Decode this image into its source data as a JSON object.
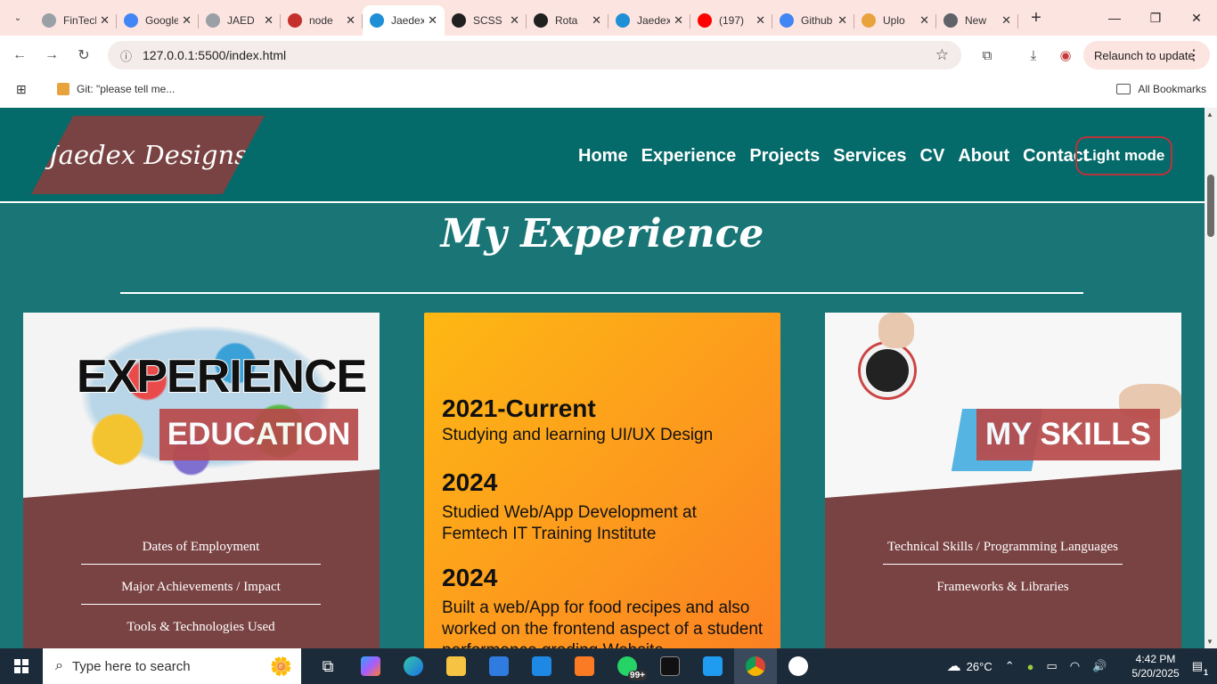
{
  "browser": {
    "tabs": [
      {
        "title": "FinTech",
        "fav_color": "#9aa0a6",
        "active": false
      },
      {
        "title": "Google",
        "fav_color": "#4285f4",
        "active": false
      },
      {
        "title": "JAED",
        "fav_color": "#9aa0a6",
        "active": false
      },
      {
        "title": "node",
        "fav_color": "#c4302b",
        "active": false
      },
      {
        "title": "Jaedex",
        "fav_color": "#1f8fd6",
        "active": true
      },
      {
        "title": "SCSS",
        "fav_color": "#202020",
        "active": false
      },
      {
        "title": "Rota",
        "fav_color": "#202020",
        "active": false
      },
      {
        "title": "Jaedex",
        "fav_color": "#1f8fd6",
        "active": false
      },
      {
        "title": "(197)",
        "fav_color": "#ff0000",
        "active": false
      },
      {
        "title": "Github",
        "fav_color": "#4285f4",
        "active": false
      },
      {
        "title": "Uplo",
        "fav_color": "#e8a33d",
        "active": false
      },
      {
        "title": "New",
        "fav_color": "#5f6368",
        "active": false
      }
    ],
    "url": "127.0.0.1:5500/index.html",
    "relaunch_label": "Relaunch to update",
    "bookmark": "Git: \"please tell me...",
    "all_bookmarks": "All Bookmarks"
  },
  "site": {
    "logo": "Jaedex Designs",
    "nav": [
      "Home",
      "Experience",
      "Projects",
      "Services",
      "CV",
      "About",
      "Contact"
    ],
    "mode_button": "Light mode",
    "section_title": "My Experience",
    "left_card": {
      "image_text": "EXPERIENCE",
      "badge": "EDUCATION",
      "items": [
        "Dates of Employment",
        "Major Achievements / Impact",
        "Tools & Technologies Used"
      ]
    },
    "middle_card": {
      "entries": [
        {
          "year": "2021-Current",
          "desc": "Studying and learning UI/UX Design"
        },
        {
          "year": "2024",
          "desc": "Studied Web/App Development at Femtech IT Training Institute"
        },
        {
          "year": "2024",
          "desc": "Built a web/App for food recipes and also worked on the frontend aspect of a student performance grading Website"
        }
      ]
    },
    "right_card": {
      "badge": "MY SKILLS",
      "items": [
        "Technical Skills / Programming Languages",
        "Frameworks & Libraries"
      ]
    }
  },
  "taskbar": {
    "search_placeholder": "Type here to search",
    "weather": "26°C",
    "time": "4:42 PM",
    "date": "5/20/2025",
    "badge_count": "99+",
    "notifications": "1"
  },
  "colors": {
    "teal_header": "#056a6a",
    "teal_bg": "#1a7676",
    "maroon": "#7a4343",
    "badge_red": "#b84a4a",
    "orange_grad_start": "#fdb813",
    "orange_grad_end": "#fb7f22"
  }
}
